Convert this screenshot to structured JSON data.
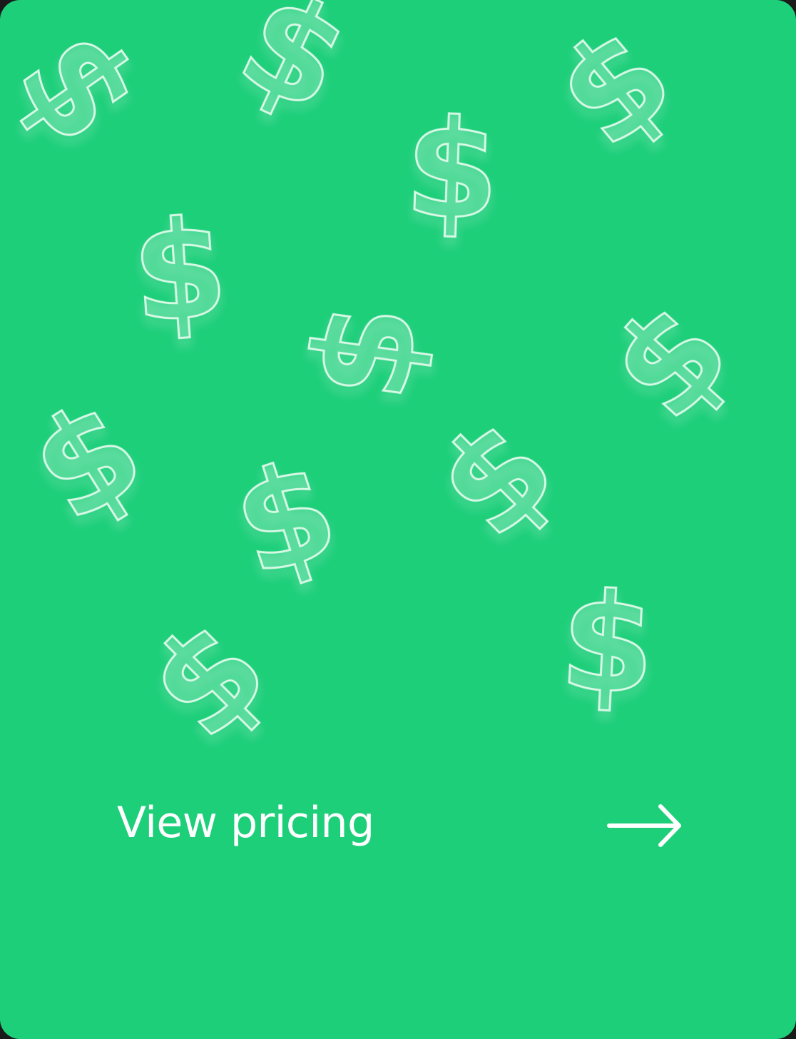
{
  "card": {
    "background_color": "#1ecf7a",
    "decoration_glyph": "$",
    "decoration_icon": "dollar-sign-icon"
  },
  "cta": {
    "label": "View pricing",
    "icon": "arrow-right-icon",
    "text_color": "#ffffff"
  }
}
